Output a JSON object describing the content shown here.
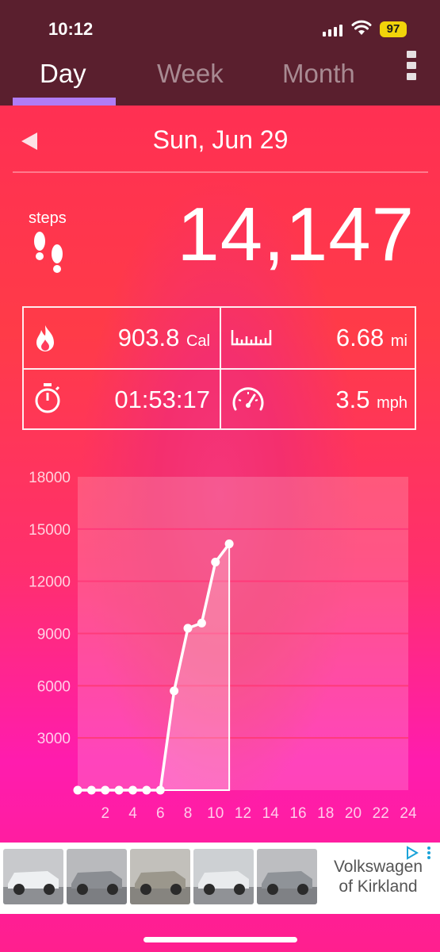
{
  "status_bar": {
    "time": "10:12",
    "battery": "97"
  },
  "tabs": [
    {
      "label": "Day",
      "selected": true
    },
    {
      "label": "Week",
      "selected": false
    },
    {
      "label": "Month",
      "selected": false
    }
  ],
  "date": "Sun, Jun 29",
  "steps": {
    "label": "steps",
    "value": "14,147"
  },
  "stats": {
    "calories": {
      "value": "903.8",
      "unit": "Cal"
    },
    "distance": {
      "value": "6.68",
      "unit": "mi"
    },
    "duration": {
      "value": "01:53:17"
    },
    "speed": {
      "value": "3.5",
      "unit": "mph"
    }
  },
  "chart_data": {
    "type": "line",
    "ylim": [
      0,
      18000
    ],
    "xlim": [
      0,
      24
    ],
    "y_ticks": [
      3000,
      6000,
      9000,
      12000,
      15000,
      18000
    ],
    "x_ticks": [
      2,
      4,
      6,
      8,
      10,
      12,
      14,
      16,
      18,
      20,
      22,
      24
    ],
    "x": [
      0,
      1,
      2,
      3,
      4,
      5,
      6,
      7,
      8,
      9,
      10,
      11
    ],
    "y": [
      0,
      0,
      0,
      0,
      0,
      0,
      0,
      5700,
      9300,
      9600,
      13100,
      14147
    ],
    "grid": true
  },
  "ad": {
    "brand": "Volkswagen of Kirkland",
    "brand_line1": "Volkswagen",
    "brand_line2": "of Kirkland"
  },
  "colors": {
    "top_bar": "#5a1f2e",
    "tab_indicator": "#b07cf6",
    "grid": "#ff3b7a"
  }
}
